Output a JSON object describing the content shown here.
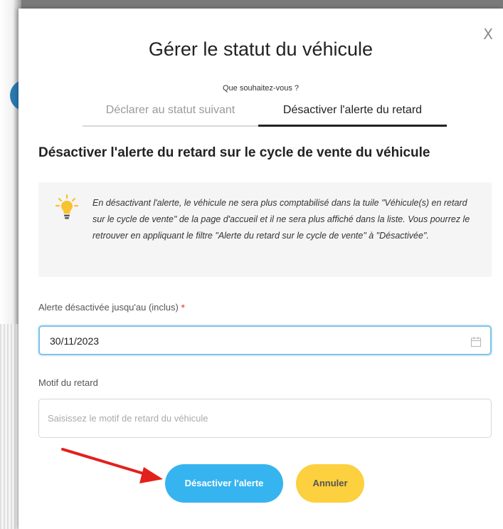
{
  "modal": {
    "title": "Gérer le statut du véhicule",
    "close_label": "X",
    "question": "Que souhaitez-vous ?",
    "tabs": [
      {
        "label": "Déclarer au statut suivant",
        "active": false
      },
      {
        "label": "Désactiver l'alerte du retard",
        "active": true
      }
    ],
    "section_title": "Désactiver l'alerte du retard sur le cycle de vente du véhicule",
    "info": {
      "icon": "lightbulb-icon",
      "text": "En désactivant l'alerte, le véhicule ne sera plus comptabilisé dans la tuile \"Véhicule(s) en retard sur le cycle de vente\" de la page d'accueil et il ne sera plus affiché dans la liste. Vous pourrez le retrouver en appliquant le filtre \"Alerte du retard sur le cycle de vente\" à \"Désactivée\"."
    },
    "date_field": {
      "label": "Alerte désactivée jusqu'au (inclus)",
      "required_mark": "*",
      "value": "30/11/2023",
      "icon": "calendar-icon"
    },
    "reason_field": {
      "label": "Motif du retard",
      "placeholder": "Saisissez le motif de retard du véhicule",
      "value": ""
    },
    "buttons": {
      "confirm": "Désactiver l'alerte",
      "cancel": "Annuler"
    }
  },
  "colors": {
    "primary": "#36b4f0",
    "secondary": "#fcd03e",
    "focus_border": "#7ec3ea",
    "bulb": "#f7c32e",
    "annotation_arrow": "#e3201b"
  }
}
